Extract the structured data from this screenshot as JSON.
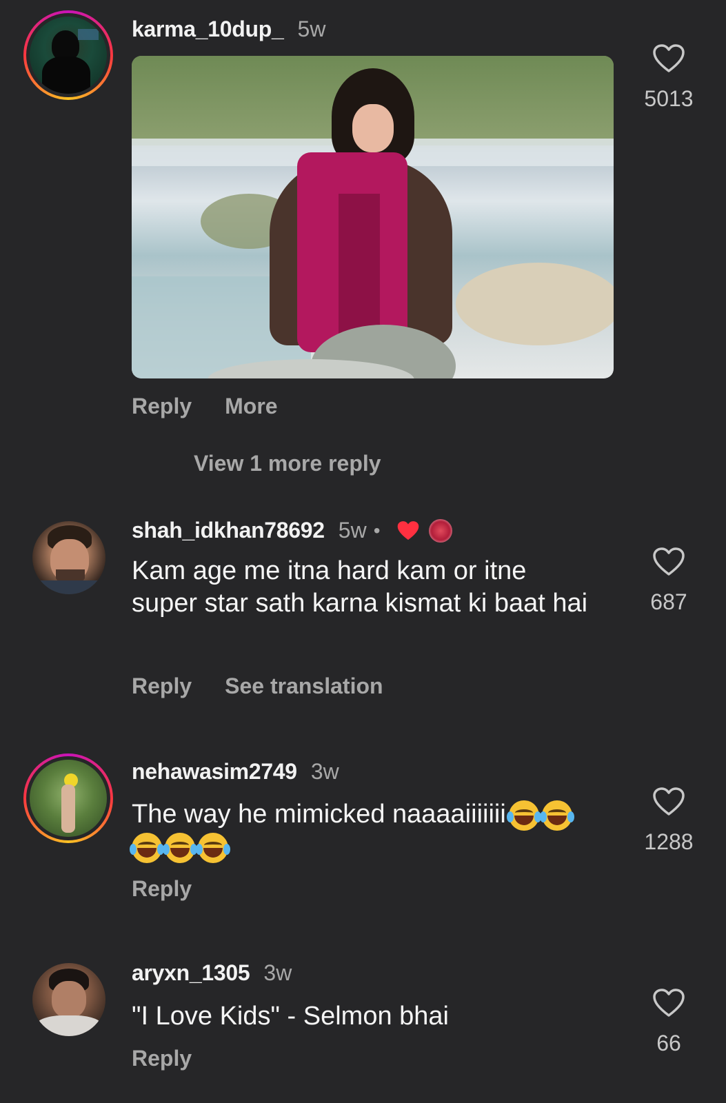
{
  "comments": [
    {
      "username": "karma_10dup_",
      "time": "5w",
      "likes": "5013",
      "actions": {
        "reply": "Reply",
        "more": "More"
      },
      "view_replies": "View 1 more reply",
      "media": "gif-image"
    },
    {
      "username": "shah_idkhan78692",
      "time": "5w",
      "separator": "•",
      "text": "Kam age me itna hard kam or itne super star sath karna kismat ki baat hai",
      "likes": "687",
      "actions": {
        "reply": "Reply",
        "translate": "See translation"
      },
      "badges": [
        "heart-icon",
        "creator-avatar"
      ]
    },
    {
      "username": "nehawasim2749",
      "time": "3w",
      "text": "The way he mimicked naaaaiiiiiii",
      "emoji_count": 5,
      "likes": "1288",
      "actions": {
        "reply": "Reply"
      }
    },
    {
      "username": "aryxn_1305",
      "time": "3w",
      "text": "\"I Love Kids\" - Selmon bhai",
      "likes": "66",
      "actions": {
        "reply": "Reply"
      }
    }
  ],
  "colors": {
    "background": "#262628",
    "muted": "#a8a8a8",
    "heart_red": "#ff3040"
  }
}
